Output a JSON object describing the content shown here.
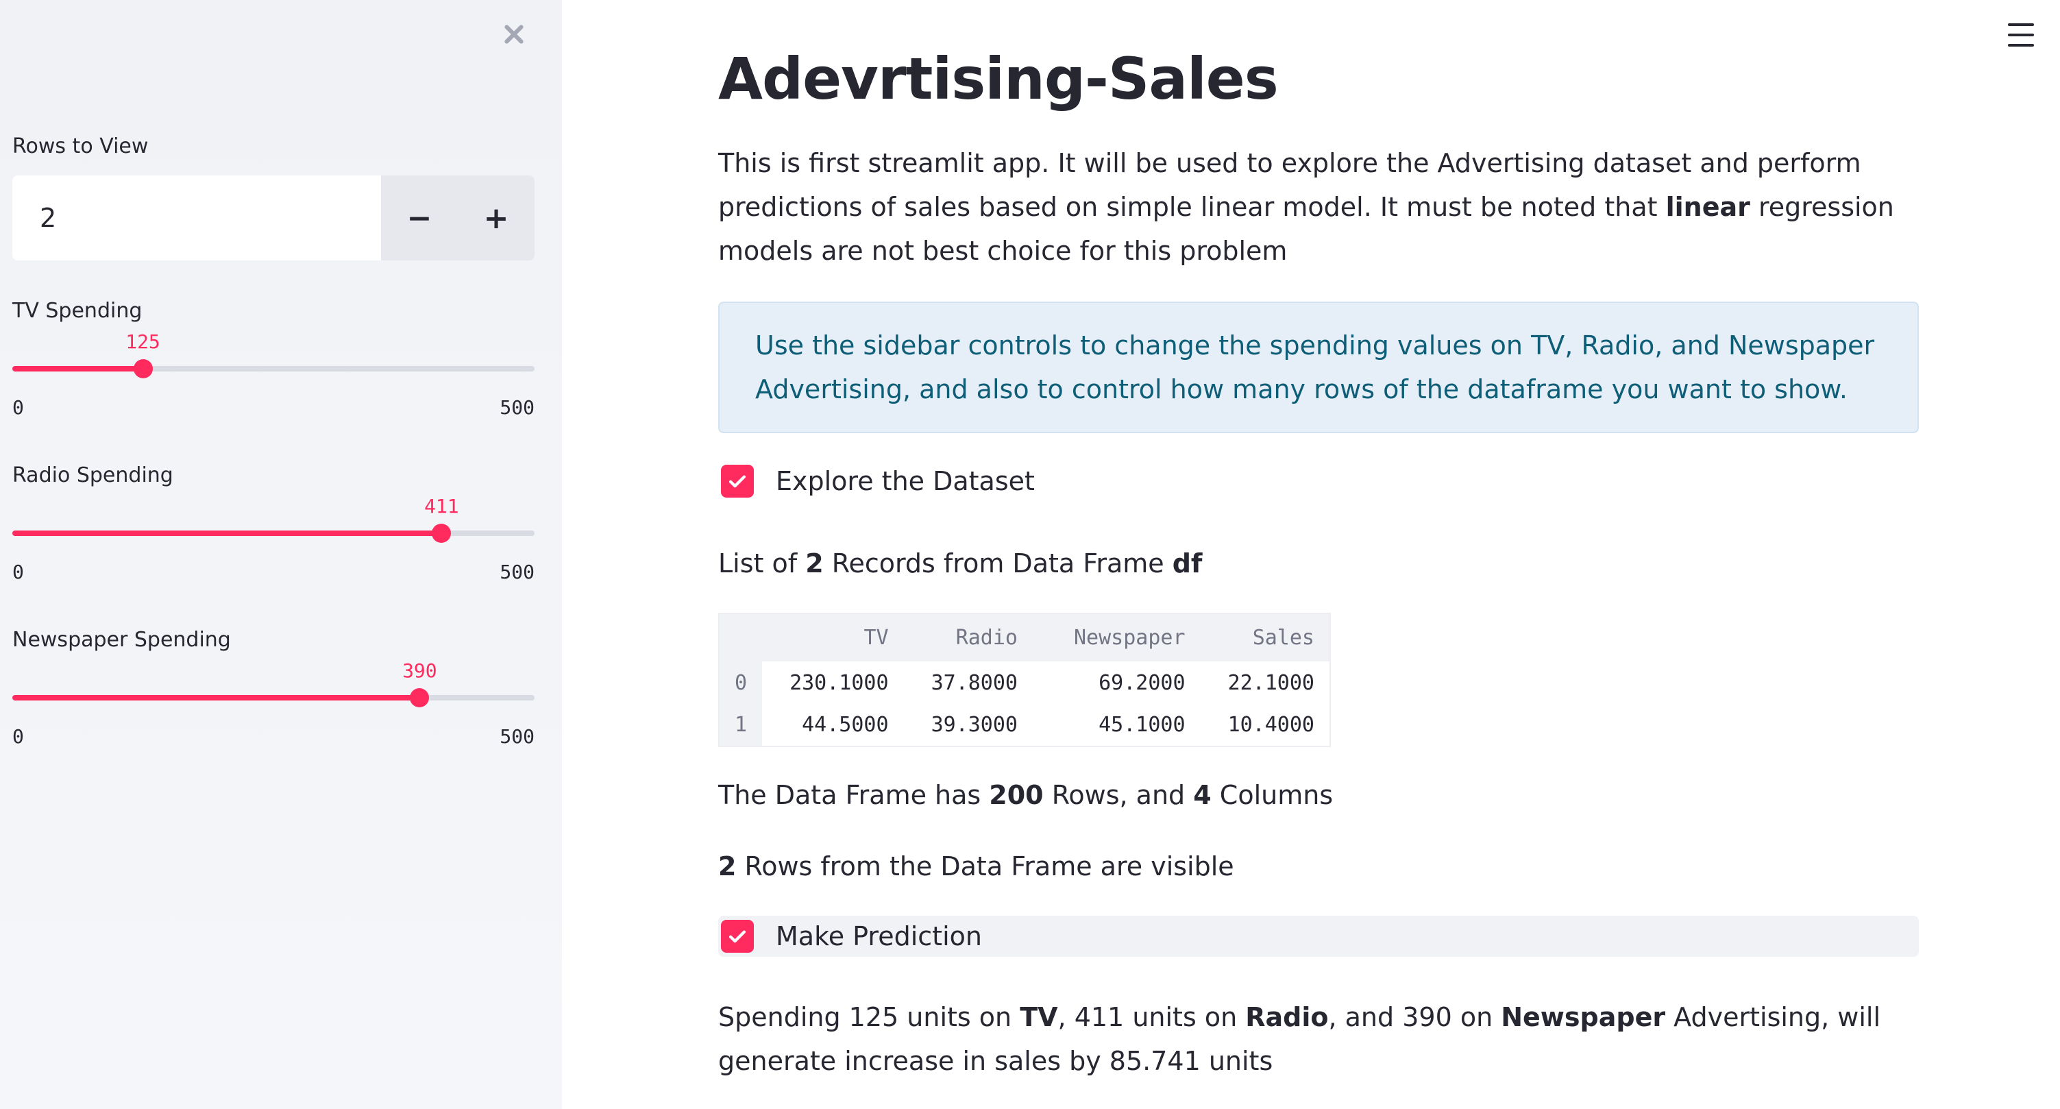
{
  "sidebar": {
    "rows_label": "Rows to View",
    "rows_value": "2",
    "minus_label": "−",
    "plus_label": "+",
    "sliders": [
      {
        "label": "TV Spending",
        "value": 125,
        "value_label": "125",
        "min": "0",
        "max": "500",
        "fraction": 0.25
      },
      {
        "label": "Radio Spending",
        "value": 411,
        "value_label": "411",
        "min": "0",
        "max": "500",
        "fraction": 0.822
      },
      {
        "label": "Newspaper Spending",
        "value": 390,
        "value_label": "390",
        "min": "0",
        "max": "500",
        "fraction": 0.78
      }
    ]
  },
  "main": {
    "title": "Adevrtising-Sales",
    "intro_before": "This is first streamlit app. It will be used to explore the Advertising dataset and perform predictions of sales based on simple linear model. It must be noted that ",
    "intro_bold": "linear",
    "intro_after": " regression models are not best choice for this problem",
    "info": "Use the sidebar controls to change the spending values on TV, Radio, and Newspaper Advertising, and also to control how many rows of the dataframe you want to show.",
    "explore_label": "Explore the Dataset",
    "list_pre": "List of ",
    "list_count": "2",
    "list_mid": " Records from Data Frame ",
    "list_df": "df",
    "table": {
      "columns": [
        "",
        "TV",
        "Radio",
        "Newspaper",
        "Sales"
      ],
      "rows": [
        [
          "0",
          "230.1000",
          "37.8000",
          "69.2000",
          "22.1000"
        ],
        [
          "1",
          "44.5000",
          "39.3000",
          "45.1000",
          "10.4000"
        ]
      ]
    },
    "shape_pre": "The Data Frame has ",
    "shape_rows": "200",
    "shape_mid": " Rows, and ",
    "shape_cols": "4",
    "shape_post": " Columns",
    "visible_count": "2",
    "visible_post": " Rows from the Data Frame are visible",
    "predict_label": "Make Prediction",
    "pred_p1": "Spending 125 units on ",
    "pred_tv": "TV",
    "pred_p2": ", 411 units on ",
    "pred_radio": "Radio",
    "pred_p3": ", and 390 on ",
    "pred_news": "Newspaper",
    "pred_p4": " Advertising, will generate increase in sales by 85.741 units"
  },
  "colors": {
    "accent": "#ff2b5e",
    "sidebar_bg": "#f0f2f6",
    "info_bg": "#e6eff8",
    "info_text": "#0e5e77"
  },
  "icons": [
    "close-icon",
    "menu-icon",
    "check-icon"
  ]
}
